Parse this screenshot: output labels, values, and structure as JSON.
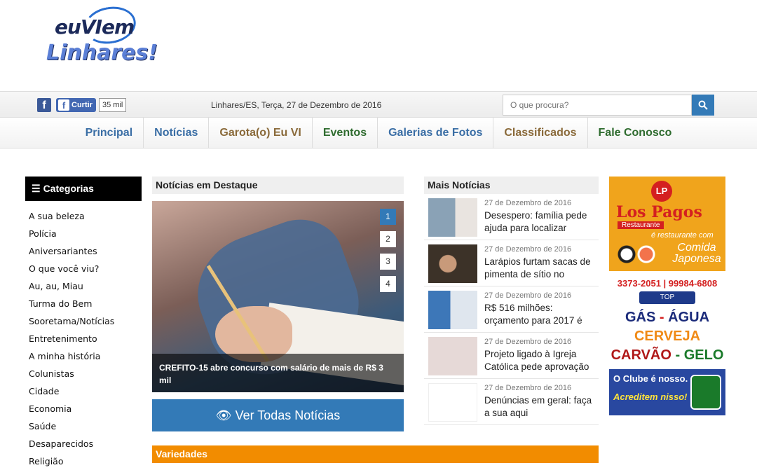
{
  "logo": {
    "line1_a": "eu",
    "line1_b": "VI",
    "line1_c": "em",
    "line2": "Linhares!"
  },
  "social": {
    "like_label": "Curtir",
    "like_count": "35 mil"
  },
  "date": "Linhares/ES, Terça, 27 de Dezembro de 2016",
  "search": {
    "placeholder": "O que procura?"
  },
  "nav": [
    {
      "label": "Principal",
      "color": "#3a6ea5"
    },
    {
      "label": "Notícias",
      "color": "#3a6ea5"
    },
    {
      "label": "Garota(o) Eu VI",
      "color": "#8a6a3a"
    },
    {
      "label": "Eventos",
      "color": "#2e6b2e"
    },
    {
      "label": "Galerias de Fotos",
      "color": "#3a6ea5"
    },
    {
      "label": "Classificados",
      "color": "#8a6a3a"
    },
    {
      "label": "Fale Conosco",
      "color": "#2e6b2e"
    }
  ],
  "categories": {
    "title": "Categorias",
    "items": [
      "A sua beleza",
      "Polícia",
      "Aniversariantes",
      "O que você viu?",
      "Au, au, Miau",
      "Turma do Bem",
      "Sooretama/Notícias",
      "Entretenimento",
      "A minha história",
      "Colunistas",
      "Cidade",
      "Economia",
      "Saúde",
      "Desaparecidos",
      "Religião"
    ]
  },
  "destaque": {
    "title": "Notícias em Destaque",
    "slides": [
      "1",
      "2",
      "3",
      "4"
    ],
    "active_slide": "1",
    "caption": "CREFITO-15 abre concurso com salário de mais de R$ 3 mil",
    "ver_todas": "Ver Todas Notícias"
  },
  "mais": {
    "title": "Mais Notícias",
    "items": [
      {
        "date": "27 de Dezembro de 2016",
        "title": "Desespero: família pede ajuda para localizar",
        "thumb": "#8aa2b6"
      },
      {
        "date": "27 de Dezembro de 2016",
        "title": "Larápios furtam sacas de pimenta de sítio no",
        "thumb": "#6b5540"
      },
      {
        "date": "27 de Dezembro de 2016",
        "title": "R$ 516 milhões: orçamento para 2017 é",
        "thumb": "#3d77b8"
      },
      {
        "date": "27 de Dezembro de 2016",
        "title": "Projeto ligado à Igreja Católica pede aprovação",
        "thumb": "#d9c9c9"
      },
      {
        "date": "27 de Dezembro de 2016",
        "title": "Denúncias em geral: faça a sua aqui",
        "thumb": "#ffffff"
      }
    ]
  },
  "ad": {
    "lp": "LP",
    "name": "Los Pagos",
    "sub": "Restaurante",
    "eh": "é restaurante com",
    "cj": "Comida Japonesa",
    "phones": "3373-2051 | 99984-6808",
    "toptag": "TOP",
    "g1a": "GÁS",
    "g1b": "ÁGUA",
    "g2": "CERVEJA",
    "g3a": "CARVÃO",
    "g3b": "GELO",
    "c1": "O Clube é nosso.",
    "c2": "Acreditem nisso!"
  },
  "variedades": "Variedades"
}
